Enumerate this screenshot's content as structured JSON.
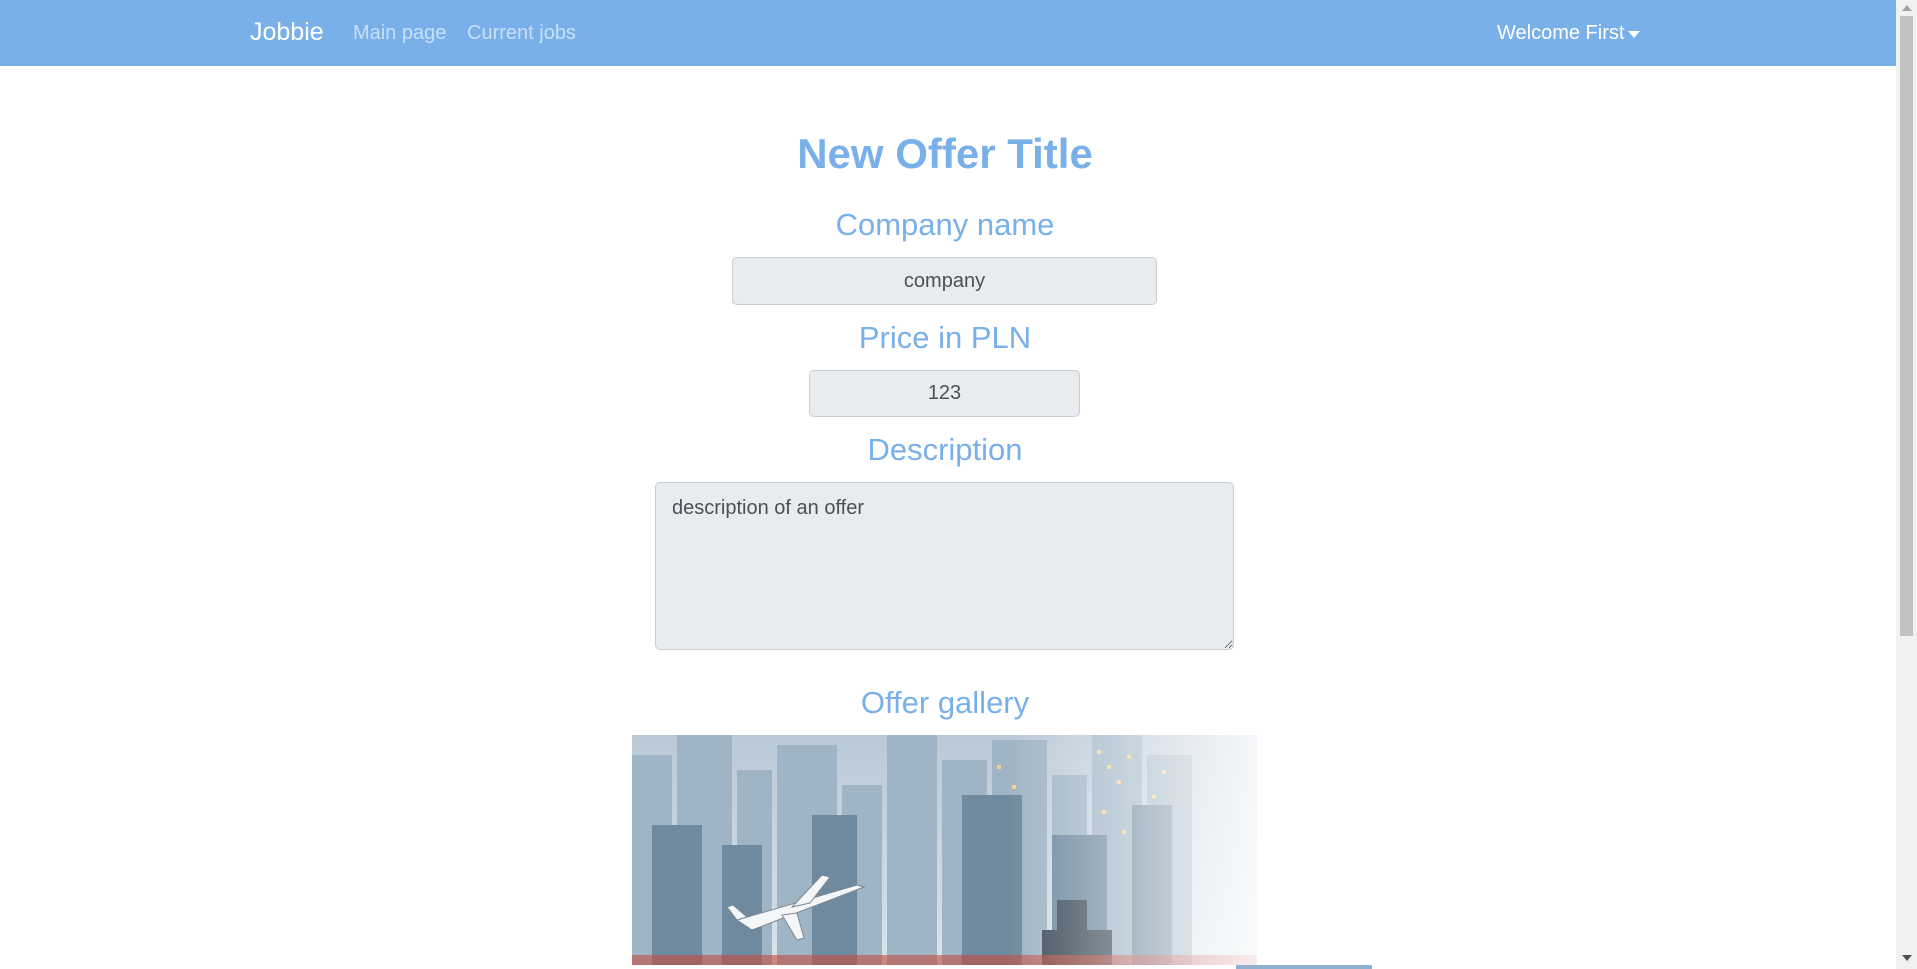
{
  "navbar": {
    "brand": "Jobbie",
    "links": [
      {
        "label": "Main page"
      },
      {
        "label": "Current jobs"
      }
    ],
    "user_menu_label": "Welcome First",
    "bg_color": "#79b0ea"
  },
  "form": {
    "title": "New Offer Title",
    "company_label": "Company name",
    "company_value": "company",
    "price_label": "Price in PLN",
    "price_value": "123",
    "description_label": "Description",
    "description_value": "description of an offer",
    "accent_color": "#79b0ea"
  },
  "gallery": {
    "label": "Offer gallery",
    "images": [
      {
        "icon": "city-airplane-photo"
      },
      {
        "icon": "gallery-thumbnail"
      }
    ]
  }
}
